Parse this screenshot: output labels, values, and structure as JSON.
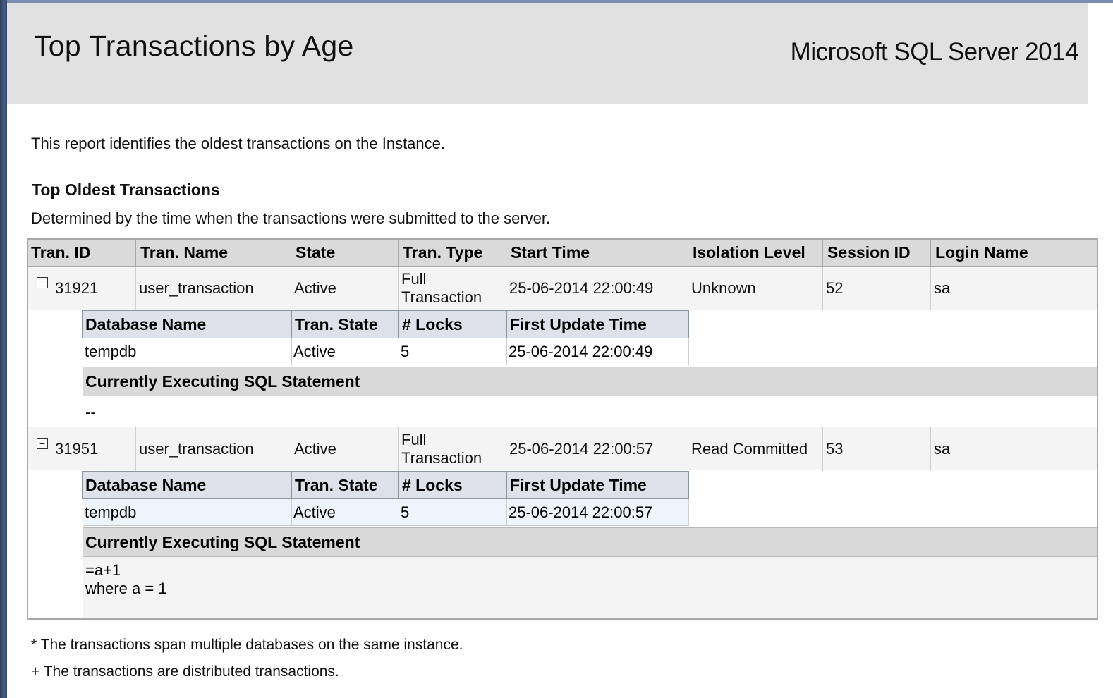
{
  "header": {
    "title": "Top Transactions by Age",
    "product": "Microsoft SQL Server 2014"
  },
  "description": "This report identifies the oldest transactions on the Instance.",
  "section": {
    "title": "Top Oldest Transactions",
    "subtitle": "Determined by the time when the transactions were submitted to the server."
  },
  "columns": [
    "Tran. ID",
    "Tran. Name",
    "State",
    "Tran. Type",
    "Start Time",
    "Isolation Level",
    "Session ID",
    "Login Name"
  ],
  "sub_columns": [
    "Database Name",
    "Tran. State",
    "# Locks",
    "First Update Time"
  ],
  "sql_header": "Currently Executing SQL Statement",
  "toggle_symbol": "−",
  "transactions": [
    {
      "tran_id": "31921",
      "tran_name": "user_transaction",
      "state": "Active",
      "tran_type": "Full Transaction",
      "start_time": "25-06-2014 22:00:49",
      "isolation_level": "Unknown",
      "session_id": "52",
      "login_name": "sa",
      "db": {
        "database_name": "tempdb",
        "tran_state": "Active",
        "locks": "5",
        "first_update_time": "25-06-2014 22:00:49"
      },
      "sql": "--"
    },
    {
      "tran_id": "31951",
      "tran_name": "user_transaction",
      "state": "Active",
      "tran_type": "Full Transaction",
      "start_time": "25-06-2014 22:00:57",
      "isolation_level": "Read Committed",
      "session_id": "53",
      "login_name": "sa",
      "db": {
        "database_name": "tempdb",
        "tran_state": "Active",
        "locks": "5",
        "first_update_time": "25-06-2014 22:00:57"
      },
      "sql": "=a+1\nwhere a = 1"
    }
  ],
  "footnotes": [
    "* The transactions span multiple databases on the same instance.",
    "+ The transactions are distributed transactions."
  ]
}
